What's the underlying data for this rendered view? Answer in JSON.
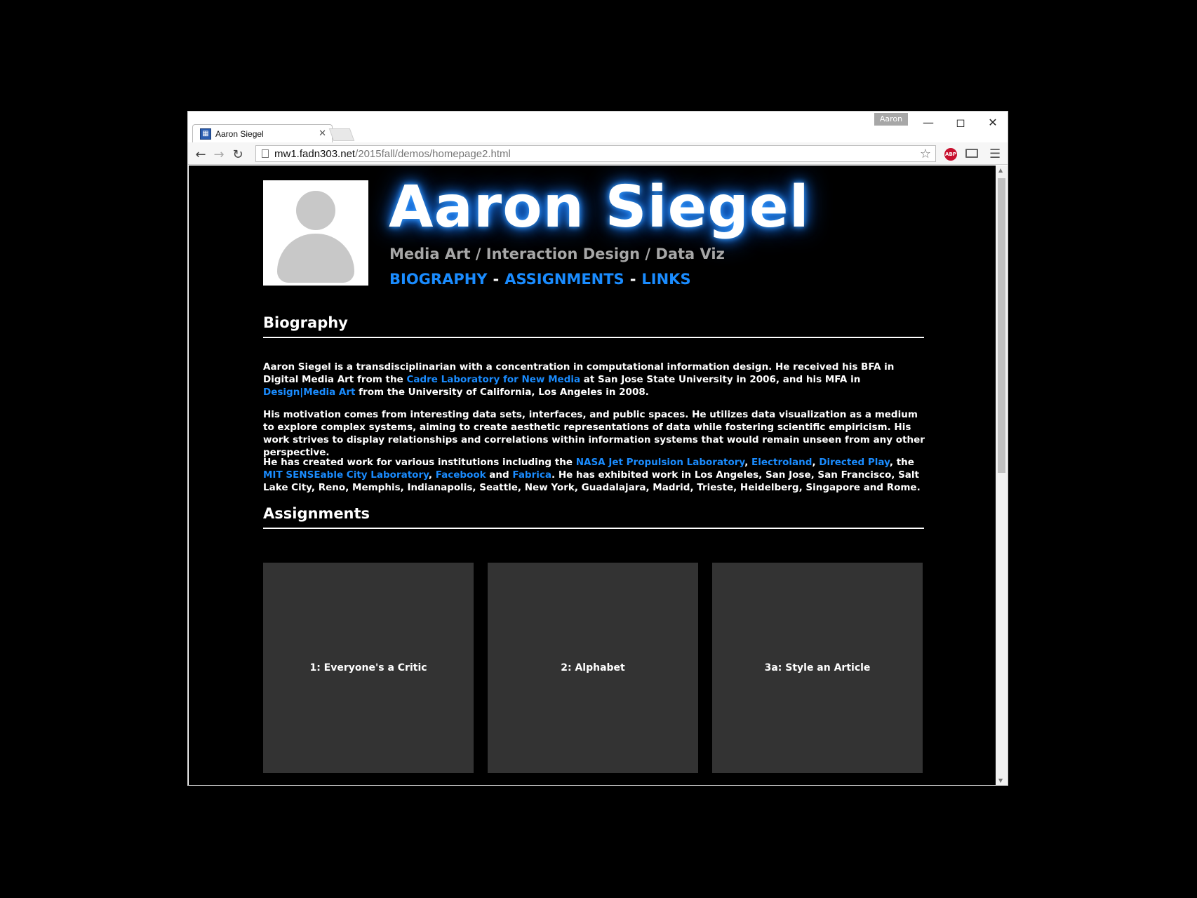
{
  "browser": {
    "profile_name": "Aaron",
    "tab_title": "Aaron Siegel",
    "tab_favicon": "favicon-icon",
    "url_host": "mw1.fadn303.net",
    "url_path": "/2015fall/demos/homepage2.html",
    "extension_label": "ABP"
  },
  "header": {
    "name": "Aaron Siegel",
    "subtitle": "Media Art / Interaction Design / Data Viz",
    "nav": [
      "BIOGRAPHY",
      "ASSIGNMENTS",
      "LINKS"
    ],
    "nav_separator": "-"
  },
  "biography": {
    "heading": "Biography",
    "p1": {
      "t1": "Aaron Siegel is a transdisciplinarian with a concentration in computational information design. He received his BFA in Digital Media Art from the ",
      "l1": "Cadre Laboratory for New Media",
      "t2": " at San Jose State University in 2006, and his MFA in ",
      "l2": "Design|Media Art",
      "t3": " from the University of California, Los Angeles in 2008."
    },
    "p2": "His motivation comes from interesting data sets, interfaces, and public spaces. He utilizes data visualization as a medium to explore complex systems, aiming to create aesthetic representations of data while fostering scientific empiricism. His work strives to display relationships and correlations within information systems that would remain unseen from any other perspective.",
    "p3": {
      "t1": "He has created work for various institutions including the ",
      "l1": "NASA Jet Propulsion Laboratory",
      "t2": ", ",
      "l2": "Electroland",
      "t3": ", ",
      "l3": "Directed Play",
      "t4": ", the ",
      "l4": "MIT SENSEable City Laboratory",
      "t5": ", ",
      "l5": "Facebook",
      "t6": " and ",
      "l6": "Fabrica",
      "t7": ". He has exhibited work in Los Angeles, San Jose, San Francisco, Salt Lake City, Reno, Memphis, Indianapolis, Seattle, New York, Guadalajara, Madrid, Trieste, Heidelberg, Singapore and Rome."
    }
  },
  "assignments": {
    "heading": "Assignments",
    "items": [
      "1: Everyone's a Critic",
      "2: Alphabet",
      "3a: Style an Article"
    ]
  },
  "colors": {
    "link": "#1a8cff",
    "card_bg": "#333333",
    "subtitle": "#a7a7a7",
    "glow": "#1b7fff"
  }
}
